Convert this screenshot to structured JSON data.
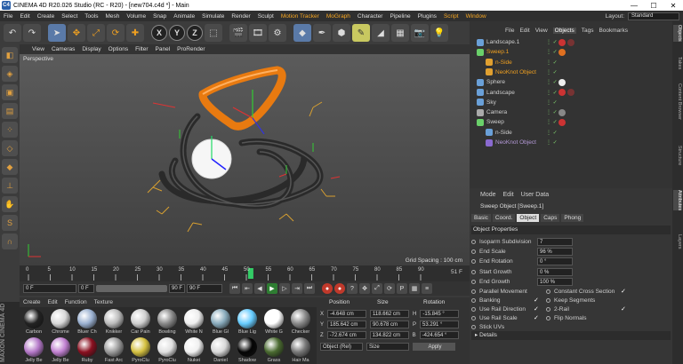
{
  "title": "CINEMA 4D R20.026 Studio (RC - R20) - [new704.c4d *] - Main",
  "logo_text": "C4",
  "window_controls": {
    "minimize": "—",
    "maximize": "☐",
    "close": "✕"
  },
  "menu": [
    "File",
    "Edit",
    "Create",
    "Select",
    "Tools",
    "Mesh",
    "Volume",
    "Snap",
    "Animate",
    "Simulate",
    "Render",
    "Sculpt",
    "Motion Tracker",
    "MoGraph",
    "Character",
    "Pipeline",
    "Plugins",
    "Script",
    "Window"
  ],
  "layout_label": "Layout:",
  "layout_value": "Standard",
  "viewport": {
    "menu": [
      "View",
      "Cameras",
      "Display",
      "Options",
      "Filter",
      "Panel",
      "ProRender"
    ],
    "label": "Perspective",
    "grid_spacing": "Grid Spacing : 100 cm"
  },
  "toolbar": {
    "x": "X",
    "y": "Y",
    "z": "Z"
  },
  "timeline": {
    "ticks": [
      "0",
      "5",
      "10",
      "15",
      "20",
      "25",
      "30",
      "35",
      "40",
      "45",
      "50",
      "55",
      "60",
      "65",
      "70",
      "75",
      "80",
      "85",
      "90"
    ],
    "current_frame": "51 F",
    "start": "0 F",
    "min": "0 F",
    "max": "90 F",
    "end": "90 F"
  },
  "material_menu": [
    "Create",
    "Edit",
    "Function",
    "Texture"
  ],
  "materials": [
    {
      "name": "Carbon",
      "color": "#222"
    },
    {
      "name": "Chrome",
      "color": "#d8d8d8"
    },
    {
      "name": "Bluer Ch",
      "color": "#9ab0d0"
    },
    {
      "name": "Knikker",
      "color": "#bbb"
    },
    {
      "name": "Car Pain",
      "color": "#cfcfcf"
    },
    {
      "name": "Bowling",
      "color": "#888"
    },
    {
      "name": "White N",
      "color": "#eee"
    },
    {
      "name": "Blue Gl",
      "color": "#8ab"
    },
    {
      "name": "Blue Lig",
      "color": "#6cf"
    },
    {
      "name": "White G",
      "color": "#fff"
    },
    {
      "name": "Checker",
      "color": "#888"
    },
    {
      "name": "Jelly Be",
      "color": "#b478c8"
    },
    {
      "name": "Jelly Be",
      "color": "#c080d0"
    },
    {
      "name": "Ruby",
      "color": "#8a1020"
    },
    {
      "name": "Fast Arc",
      "color": "#9a9a9a"
    },
    {
      "name": "PyroClu",
      "color": "#d4c040"
    },
    {
      "name": "PyroClu",
      "color": "#e0e0e0"
    },
    {
      "name": "Nukei",
      "color": "#f0f0f0"
    },
    {
      "name": "Daniel",
      "color": "#d8d8d8"
    },
    {
      "name": "Shadow",
      "color": "#050505"
    },
    {
      "name": "Grass",
      "color": "#4a6a30"
    },
    {
      "name": "Hair Ma",
      "color": "#777"
    }
  ],
  "coordinates": {
    "headers": [
      "Position",
      "Size",
      "Rotation"
    ],
    "rows": [
      {
        "axis": "X",
        "pos": "-4.648 cm",
        "size": "118.662 cm",
        "rot_axis": "H",
        "rot": "-15.845 °"
      },
      {
        "axis": "Y",
        "pos": "185.642 cm",
        "size": "90.678 cm",
        "rot_axis": "P",
        "rot": "53.291 °"
      },
      {
        "axis": "Z",
        "pos": "-72.674 cm",
        "size": "134.822 cm",
        "rot_axis": "B",
        "rot": "-424.654 °"
      }
    ],
    "mode": "Object (Rel)",
    "size_mode": "Size",
    "apply": "Apply"
  },
  "object_manager": {
    "menu": [
      "File",
      "Edit",
      "View",
      "Objects",
      "Tags",
      "Bookmarks"
    ],
    "objects": [
      {
        "name": "Landscape.1",
        "indent": 0,
        "style": "normal",
        "icon": "#6aa0d8",
        "tags": [
          "#c33",
          "#733"
        ]
      },
      {
        "name": "Sweep.1",
        "indent": 0,
        "style": "orange",
        "icon": "#6ad06a",
        "tags": [
          "#e07020"
        ]
      },
      {
        "name": "n-Side",
        "indent": 1,
        "style": "orange",
        "icon": "#e0a030",
        "tags": []
      },
      {
        "name": "NeoKnot Object",
        "indent": 1,
        "style": "orange",
        "icon": "#e0a030",
        "tags": []
      },
      {
        "name": "Sphere",
        "indent": 0,
        "style": "normal",
        "icon": "#6aa0d8",
        "tags": [
          "#eee"
        ]
      },
      {
        "name": "Landscape",
        "indent": 0,
        "style": "normal",
        "icon": "#6aa0d8",
        "tags": [
          "#c33",
          "#733"
        ]
      },
      {
        "name": "Sky",
        "indent": 0,
        "style": "normal",
        "icon": "#6aa0d8",
        "tags": []
      },
      {
        "name": "Camera",
        "indent": 0,
        "style": "normal",
        "icon": "#aaa",
        "tags": [
          "#888"
        ]
      },
      {
        "name": "Sweep",
        "indent": 0,
        "style": "normal",
        "icon": "#6ad06a",
        "tags": [
          "#c33"
        ]
      },
      {
        "name": "n-Side",
        "indent": 1,
        "style": "normal",
        "icon": "#6aa0d8",
        "tags": []
      },
      {
        "name": "NeoKnot Object",
        "indent": 1,
        "style": "purple",
        "icon": "#8a6ad0",
        "tags": []
      }
    ]
  },
  "attributes": {
    "menu": [
      "Mode",
      "Edit",
      "User Data"
    ],
    "title": "Sweep Object [Sweep.1]",
    "tabs": [
      "Basic",
      "Coord.",
      "Object",
      "Caps",
      "Phong"
    ],
    "active_tab": "Object",
    "section": "Object Properties",
    "fields": [
      {
        "label": "Isoparm Subdivision",
        "value": "7"
      },
      {
        "label": "End Scale",
        "value": "96 %"
      },
      {
        "label": "End Rotation",
        "value": "0 °"
      },
      {
        "label": "Start Growth",
        "value": "0 %"
      },
      {
        "label": "End Growth",
        "value": "100 %"
      }
    ],
    "checks_left": [
      {
        "label": "Parallel Movement",
        "checked": ""
      },
      {
        "label": "Banking",
        "checked": "✓"
      },
      {
        "label": "Use Rail Direction",
        "checked": "✓"
      },
      {
        "label": "Use Rail Scale",
        "checked": "✓"
      },
      {
        "label": "Stick UVs",
        "checked": ""
      }
    ],
    "checks_right": [
      {
        "label": "Constant Cross Section",
        "checked": "✓"
      },
      {
        "label": "Keep Segments",
        "checked": ""
      },
      {
        "label": "2-Rail",
        "checked": "✓"
      },
      {
        "label": "Flip Normals",
        "checked": ""
      }
    ],
    "details": "▸ Details"
  },
  "right_tabs": [
    "Objects",
    "Takes",
    "Content Browser",
    "Structure",
    "Attributes",
    "Layers"
  ],
  "brand_side": "MAXON CINEMA 4D"
}
